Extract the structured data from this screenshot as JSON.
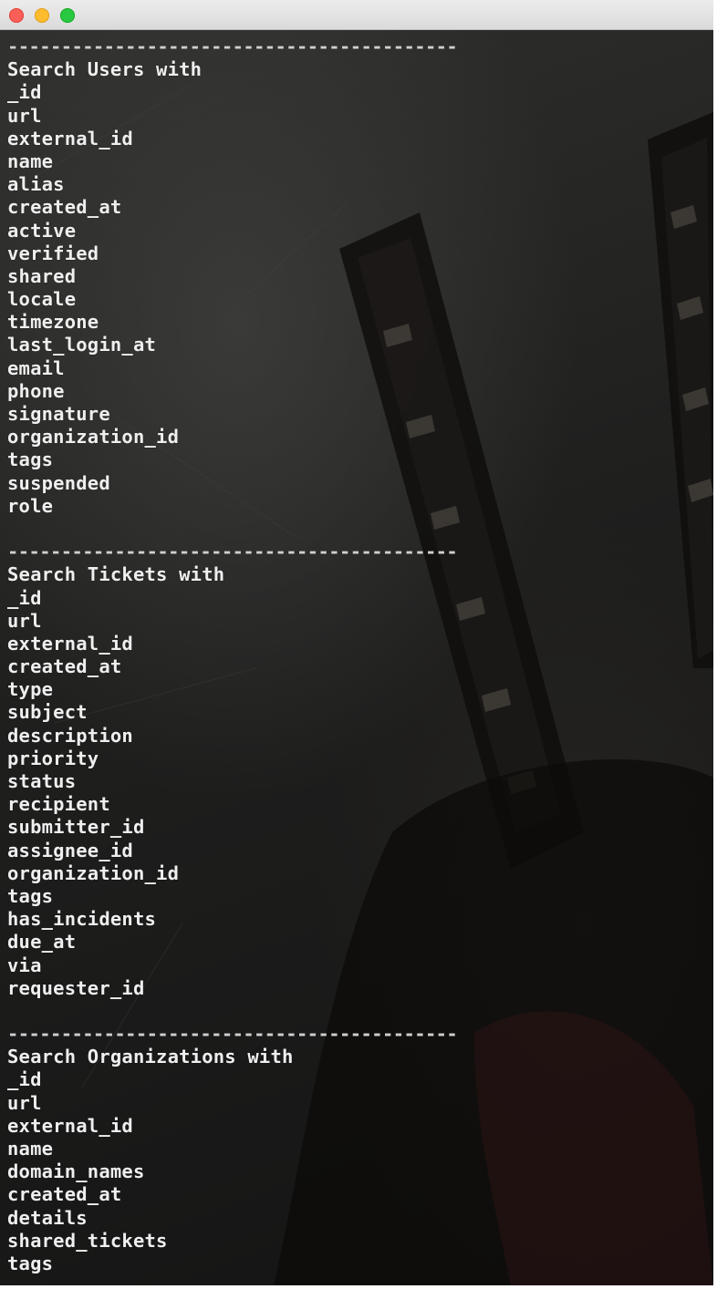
{
  "window": {
    "controls": [
      "close",
      "minimize",
      "zoom"
    ]
  },
  "separator": "------------------------------------------",
  "sections": {
    "users": {
      "heading": "Search Users with",
      "fields": [
        "_id",
        "url",
        "external_id",
        "name",
        "alias",
        "created_at",
        "active",
        "verified",
        "shared",
        "locale",
        "timezone",
        "last_login_at",
        "email",
        "phone",
        "signature",
        "organization_id",
        "tags",
        "suspended",
        "role"
      ]
    },
    "tickets": {
      "heading": "Search Tickets with",
      "fields": [
        "_id",
        "url",
        "external_id",
        "created_at",
        "type",
        "subject",
        "description",
        "priority",
        "status",
        "recipient",
        "submitter_id",
        "assignee_id",
        "organization_id",
        "tags",
        "has_incidents",
        "due_at",
        "via",
        "requester_id"
      ]
    },
    "organizations": {
      "heading": "Search Organizations with",
      "fields": [
        "_id",
        "url",
        "external_id",
        "name",
        "domain_names",
        "created_at",
        "details",
        "shared_tickets",
        "tags"
      ]
    }
  }
}
